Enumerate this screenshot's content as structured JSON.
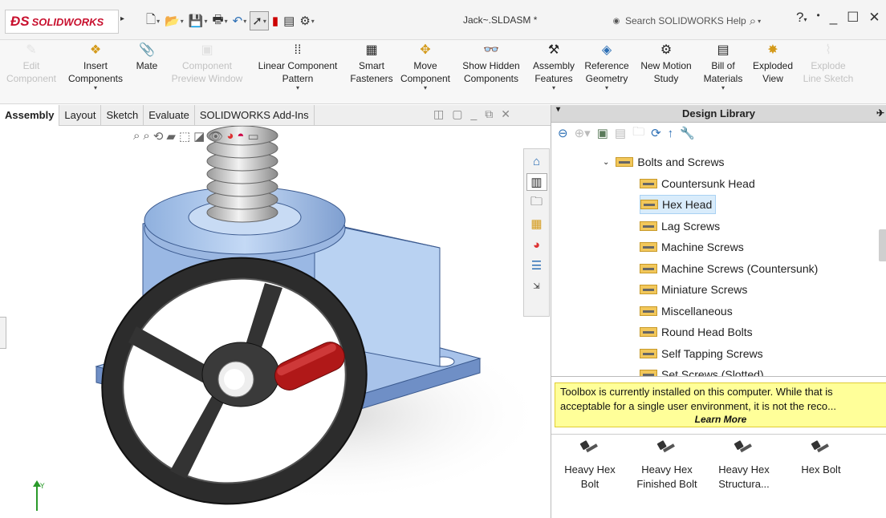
{
  "app": {
    "logo_brand": "SOLIDWORKS",
    "doc_title": "Jack~.SLDASM *",
    "search_placeholder": "Search SOLIDWORKS Help",
    "help_label": "?"
  },
  "ribbon": {
    "buttons": [
      {
        "id": "edit-component",
        "line1": "Edit",
        "line2": "Component",
        "enabled": false,
        "icon": "edit-component-icon"
      },
      {
        "id": "insert-components",
        "line1": "Insert",
        "line2": "Components",
        "enabled": true,
        "icon": "insert-components-icon"
      },
      {
        "id": "mate",
        "line1": "Mate",
        "line2": "",
        "enabled": true,
        "icon": "paperclip-icon"
      },
      {
        "id": "component-preview-window",
        "line1": "Component",
        "line2": "Preview Window",
        "enabled": false,
        "icon": "preview-window-icon"
      },
      {
        "id": "linear-component-pattern",
        "line1": "Linear Component",
        "line2": "Pattern",
        "enabled": true,
        "icon": "linear-pattern-icon"
      },
      {
        "id": "smart-fasteners",
        "line1": "Smart",
        "line2": "Fasteners",
        "enabled": true,
        "icon": "smart-fasteners-icon"
      },
      {
        "id": "move-component",
        "line1": "Move",
        "line2": "Component",
        "enabled": true,
        "icon": "move-component-icon"
      },
      {
        "id": "show-hidden-components",
        "line1": "Show Hidden",
        "line2": "Components",
        "enabled": true,
        "icon": "show-hidden-icon"
      },
      {
        "id": "assembly-features",
        "line1": "Assembly",
        "line2": "Features",
        "enabled": true,
        "icon": "assembly-features-icon"
      },
      {
        "id": "reference-geometry",
        "line1": "Reference",
        "line2": "Geometry",
        "enabled": true,
        "icon": "reference-geometry-icon"
      },
      {
        "id": "new-motion-study",
        "line1": "New Motion",
        "line2": "Study",
        "enabled": true,
        "icon": "motion-study-icon"
      },
      {
        "id": "bill-of-materials",
        "line1": "Bill of",
        "line2": "Materials",
        "enabled": true,
        "icon": "bill-of-materials-icon"
      },
      {
        "id": "exploded-view",
        "line1": "Exploded",
        "line2": "View",
        "enabled": true,
        "icon": "exploded-view-icon"
      },
      {
        "id": "explode-line-sketch",
        "line1": "Explode",
        "line2": "Line Sketch",
        "enabled": false,
        "icon": "explode-line-sketch-icon"
      }
    ]
  },
  "tabs": [
    "Assembly",
    "Layout",
    "Sketch",
    "Evaluate",
    "SOLIDWORKS Add-Ins"
  ],
  "active_tab": "Assembly",
  "design_library": {
    "title": "Design Library",
    "tree": [
      {
        "label": "Bolts and Screws",
        "level": 0,
        "expanded": true,
        "selected": false
      },
      {
        "label": "Countersunk Head",
        "level": 1,
        "selected": false
      },
      {
        "label": "Hex Head",
        "level": 1,
        "selected": true
      },
      {
        "label": "Lag Screws",
        "level": 1,
        "selected": false
      },
      {
        "label": "Machine Screws",
        "level": 1,
        "selected": false
      },
      {
        "label": "Machine Screws (Countersunk)",
        "level": 1,
        "selected": false
      },
      {
        "label": "Miniature Screws",
        "level": 1,
        "selected": false
      },
      {
        "label": "Miscellaneous",
        "level": 1,
        "selected": false
      },
      {
        "label": "Round Head Bolts",
        "level": 1,
        "selected": false
      },
      {
        "label": "Self Tapping Screws",
        "level": 1,
        "selected": false
      },
      {
        "label": "Set Screws (Slotted)",
        "level": 1,
        "selected": false
      }
    ],
    "banner_text": "Toolbox is currently installed on this computer. While that is acceptable for a single user environment, it is not the reco...",
    "banner_link": "Learn More",
    "parts": [
      {
        "line1": "Heavy Hex",
        "line2": "Bolt"
      },
      {
        "line1": "Heavy Hex",
        "line2": "Finished Bolt"
      },
      {
        "line1": "Heavy Hex",
        "line2": "Structura..."
      },
      {
        "line1": "Hex Bolt",
        "line2": ""
      }
    ]
  },
  "colors": {
    "brand_red": "#c8102e",
    "selection": "#d9ecfb",
    "banner": "#ffff99",
    "model_blue": "#b9d2f2"
  }
}
